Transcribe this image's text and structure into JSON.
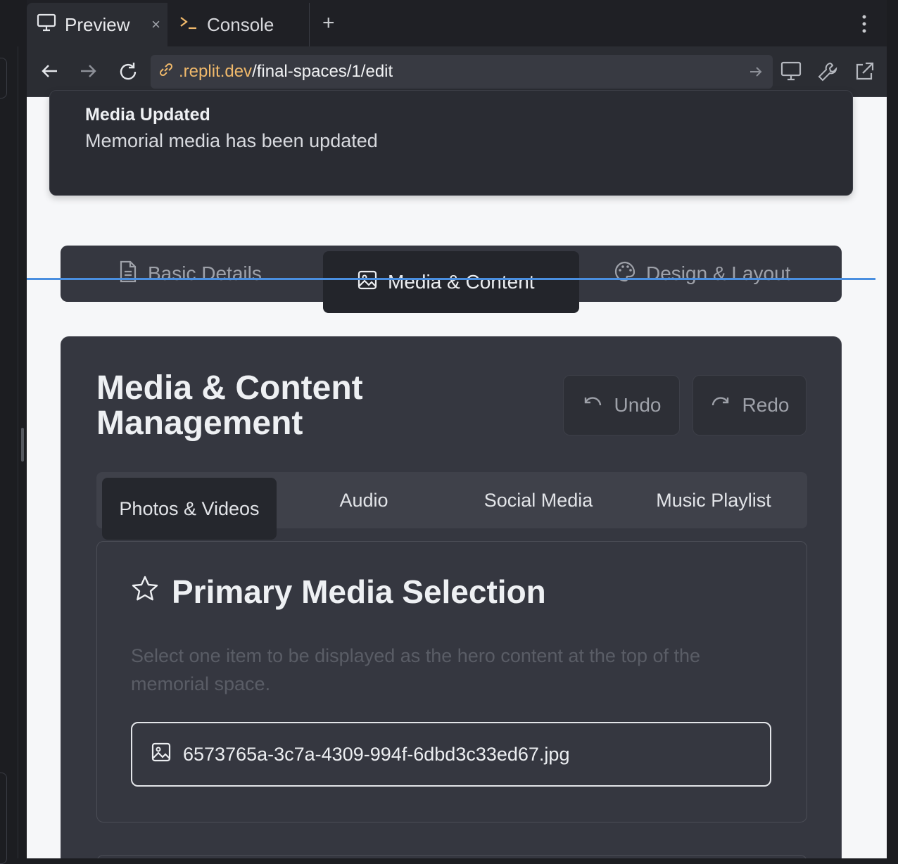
{
  "browser": {
    "tabs": [
      {
        "label": "Preview",
        "close": "×"
      },
      {
        "label": "Console"
      }
    ],
    "new_tab": "+",
    "url": {
      "subdomain": ".replit.dev",
      "path": "/final-spaces/1/edit"
    }
  },
  "toast": {
    "title": "Media Updated",
    "message": "Memorial media has been updated"
  },
  "main_tabs": [
    {
      "label": "Basic Details",
      "icon": "document-icon"
    },
    {
      "label": "Media & Content",
      "icon": "image-icon",
      "active": true
    },
    {
      "label": "Design & Layout",
      "icon": "palette-icon"
    }
  ],
  "card": {
    "title": "Media & Content Management",
    "undo_label": "Undo",
    "redo_label": "Redo",
    "sub_tabs": [
      {
        "label": "Photos & Videos",
        "active": true
      },
      {
        "label": "Audio"
      },
      {
        "label": "Social Media"
      },
      {
        "label": "Music Playlist"
      }
    ],
    "primary": {
      "title": "Primary Media Selection",
      "description": "Select one item to be displayed as the hero content at the top of the memorial space.",
      "selected_file": "6573765a-3c7a-4309-994f-6dbd3c33ed67.jpg"
    }
  },
  "colors": {
    "accent_blue": "#4a8fe0",
    "url_domain": "#f0b96b",
    "card_bg": "#353740"
  }
}
